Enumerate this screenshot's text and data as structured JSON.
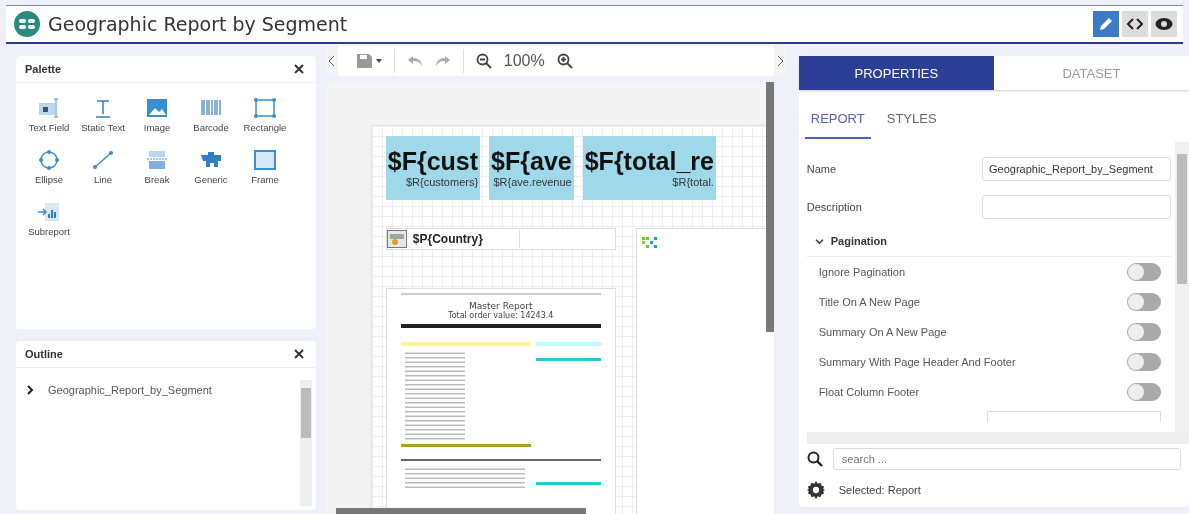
{
  "app": {
    "title": "Geographic Report by Segment",
    "modes": [
      {
        "kind": "edit",
        "selected": true
      },
      {
        "kind": "code",
        "selected": false
      },
      {
        "kind": "preview",
        "selected": false
      }
    ]
  },
  "palette": {
    "title": "Palette",
    "items": [
      {
        "label": "Text Field",
        "kind": "textfield"
      },
      {
        "label": "Static Text",
        "kind": "statictext"
      },
      {
        "label": "Image",
        "kind": "image"
      },
      {
        "label": "Barcode",
        "kind": "barcode"
      },
      {
        "label": "Rectangle",
        "kind": "rectangle"
      },
      {
        "label": "Ellipse",
        "kind": "ellipse"
      },
      {
        "label": "Line",
        "kind": "line"
      },
      {
        "label": "Break",
        "kind": "break"
      },
      {
        "label": "Generic",
        "kind": "generic"
      },
      {
        "label": "Frame",
        "kind": "frame"
      },
      {
        "label": "Subreport",
        "kind": "subreport"
      }
    ]
  },
  "outline": {
    "title": "Outline",
    "tree": [
      {
        "label": "Geographic_Report_by_Segment",
        "expanded": false
      }
    ]
  },
  "toolbar": {
    "zoom": "100%"
  },
  "canvas": {
    "fields": [
      {
        "expression": "$F{cust",
        "label": "$R{customers}"
      },
      {
        "expression": "$F{ave",
        "label": "$R{ave.revenue"
      },
      {
        "expression": "$F{total_re",
        "label": "$R{total."
      }
    ],
    "country": "$P{Country}",
    "subreport": {
      "title": "Master Report",
      "subtitle": "Total order value: 14243.4"
    }
  },
  "properties": {
    "tabs": [
      {
        "label": "PROPERTIES",
        "selected": true
      },
      {
        "label": "DATASET",
        "selected": false
      }
    ],
    "subtabs": [
      {
        "label": "REPORT",
        "selected": true
      },
      {
        "label": "STYLES",
        "selected": false
      }
    ],
    "name_label": "Name",
    "name_value": "Geographic_Report_by_Segment",
    "description_label": "Description",
    "section": {
      "title": "Pagination",
      "expanded": true
    },
    "options": [
      {
        "label": "Ignore Pagination",
        "on": false
      },
      {
        "label": "Title On A New Page",
        "on": false
      },
      {
        "label": "Summary On A New Page",
        "on": false
      },
      {
        "label": "Summary With Page Header And Footer",
        "on": false
      },
      {
        "label": "Float Column Footer",
        "on": false
      }
    ],
    "search": {
      "placeholder": "search ..."
    },
    "selected": "Selected: Report"
  }
}
